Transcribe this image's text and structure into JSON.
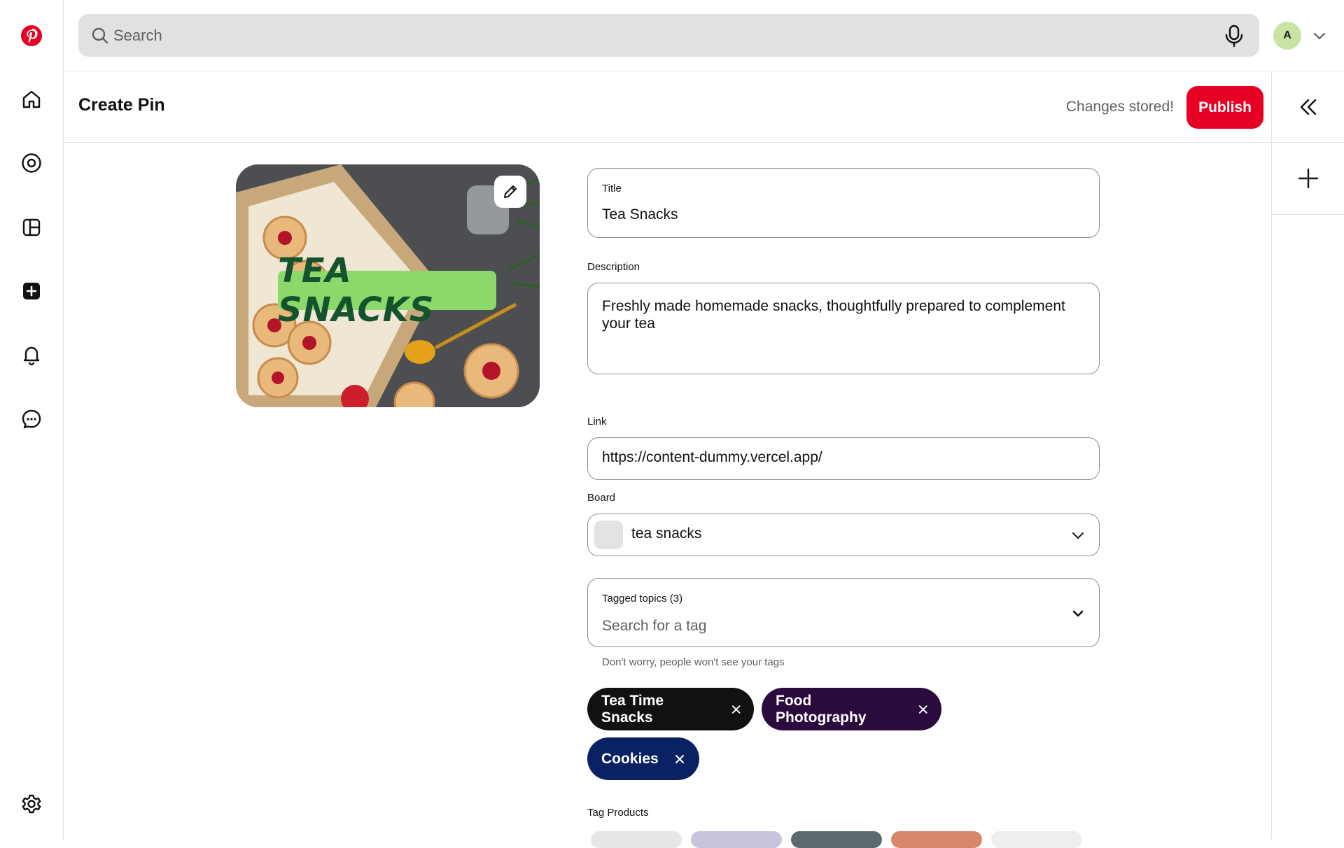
{
  "search": {
    "placeholder": "Search"
  },
  "account": {
    "initial": "A"
  },
  "header": {
    "title": "Create Pin",
    "status": "Changes stored!",
    "publish_label": "Publish"
  },
  "pin": {
    "overlay_text": "TEA SNACKS"
  },
  "form": {
    "title": {
      "label": "Title",
      "value": "Tea Snacks"
    },
    "description": {
      "label": "Description",
      "value": "Freshly made homemade snacks, thoughtfully prepared to complement your tea"
    },
    "link": {
      "label": "Link",
      "value": "https://content-dummy.vercel.app/"
    },
    "board": {
      "label": "Board",
      "value": "tea snacks"
    },
    "tags": {
      "label": "Tagged topics (3)",
      "placeholder": "Search for a tag",
      "helper": "Don't worry, people won't see your tags",
      "items": [
        "Tea Time Snacks",
        "Food Photography",
        "Cookies"
      ]
    },
    "products": {
      "label": "Tag Products"
    }
  },
  "icons": {
    "rail": [
      "pinterest-logo-icon",
      "home-icon",
      "explore-icon",
      "boards-icon",
      "create-icon",
      "notifications-icon",
      "messages-icon",
      "settings-icon"
    ],
    "right_rail": [
      "collapse-double-chevron-icon",
      "add-icon"
    ]
  },
  "colors": {
    "brand": "#e60023",
    "search_bg": "#e1e1e1",
    "avatar_bg": "#c9e3a3",
    "chip_1": "#111111",
    "chip_2": "#2b0a3d",
    "chip_3": "#0a2263"
  }
}
